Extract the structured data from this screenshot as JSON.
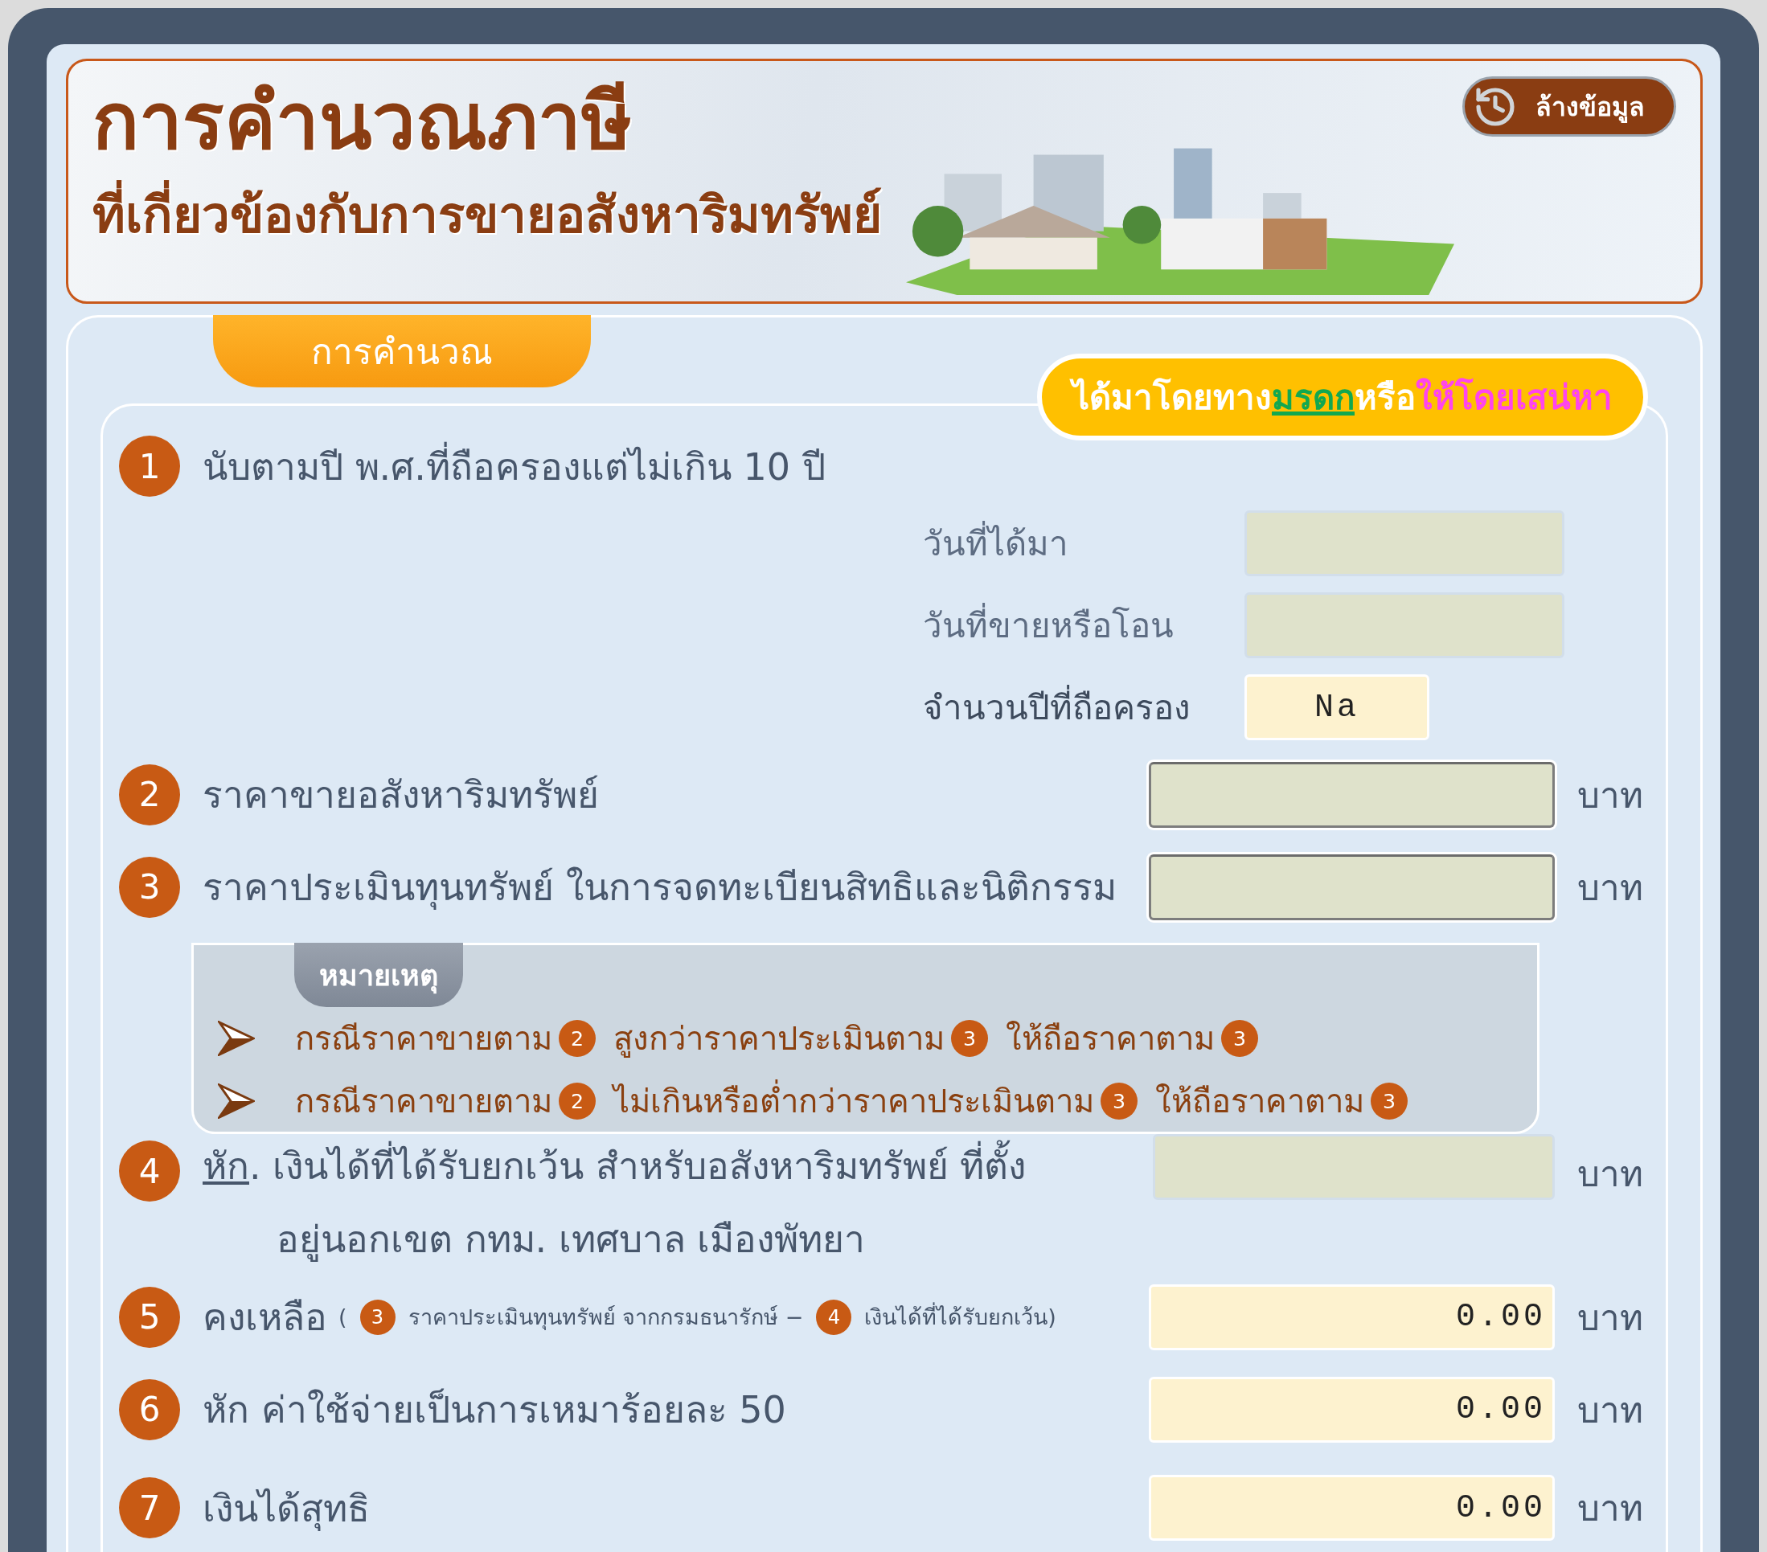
{
  "header": {
    "title": "การคำนวณภาษี",
    "subtitle": "ที่เกี่ยวข้องกับการขายอสังหาริมทรัพย์",
    "clear_button": "ล้างข้อมูล"
  },
  "tab": {
    "label": "การคำนวณ"
  },
  "badge": [
    {
      "text": "ได้มาโดยทาง",
      "kind": "plain"
    },
    {
      "text": "มรดก",
      "kind": "green"
    },
    {
      "text": "หรือ",
      "kind": "plain"
    },
    {
      "text": "ให้โดยเสน่หา",
      "kind": "pink"
    }
  ],
  "rows": [
    {
      "kind": "dates",
      "number": "1",
      "label": "นับตามปี พ.ศ.ที่ถือครองแต่ไม่เกิน 10 ปี",
      "fields": [
        {
          "label": "วันที่ได้มา",
          "kind": "plain"
        },
        {
          "label": "วันที่ขายหรือโอน",
          "kind": "plain"
        },
        {
          "label": "จำนวนปีที่ถือครอง",
          "kind": "result",
          "value": "Na"
        }
      ]
    },
    {
      "kind": "input",
      "number": "2",
      "label": "ราคาขายอสังหาริมทรัพย์",
      "field": {
        "kind": "sunken"
      },
      "unit": "บาท"
    },
    {
      "kind": "input",
      "number": "3",
      "label": "ราคาประเมินทุนทรัพย์ ในการจดทะเบียนสิทธิและนิติกรรม",
      "field": {
        "kind": "sunken"
      },
      "unit": "บาท"
    },
    {
      "kind": "notes",
      "title": "หมายเหตุ",
      "lines": [
        [
          {
            "kind": "text",
            "text": "กรณีราคาขายตาม"
          },
          {
            "kind": "ref",
            "text": "2"
          },
          {
            "kind": "text",
            "text": "สูงกว่าราคาประเมินตาม"
          },
          {
            "kind": "ref",
            "text": "3"
          },
          {
            "kind": "text",
            "text": "ให้ถือราคาตาม"
          },
          {
            "kind": "ref",
            "text": "3"
          }
        ],
        [
          {
            "kind": "text",
            "text": "กรณีราคาขายตาม"
          },
          {
            "kind": "ref",
            "text": "2"
          },
          {
            "kind": "text",
            "text": "ไม่เกินหรือต่ำกว่าราคาประเมินตาม"
          },
          {
            "kind": "ref",
            "text": "3"
          },
          {
            "kind": "text",
            "text": "ให้ถือราคาตาม"
          },
          {
            "kind": "ref",
            "text": "3"
          }
        ]
      ]
    },
    {
      "kind": "input",
      "number": "4",
      "prefix": {
        "text": "หัก",
        "underlined": true
      },
      "label": ". เงินได้ที่ได้รับยกเว้น สำหรับอสังหาริมทรัพย์ ที่ตั้ง",
      "label_line2": "อยู่นอกเขต กทม. เทศบาล  เมืองพัทยา",
      "field": {
        "kind": "plain"
      },
      "unit": "บาท"
    },
    {
      "kind": "input",
      "number": "5",
      "label": "คงเหลือ",
      "formula": [
        {
          "kind": "text",
          "text": "("
        },
        {
          "kind": "ref",
          "text": "3"
        },
        {
          "kind": "text",
          "text": "ราคาประเมินทุนทรัพย์ จากกรมธนารักษ์  −"
        },
        {
          "kind": "ref",
          "text": "4"
        },
        {
          "kind": "text",
          "text": "เงินได้ที่ได้รับยกเว้น)"
        }
      ],
      "field": {
        "kind": "result",
        "value": "0.00"
      },
      "unit": "บาท"
    },
    {
      "kind": "input",
      "number": "6",
      "label": "หัก  ค่าใช้จ่ายเป็นการเหมาร้อยละ 50",
      "field": {
        "kind": "result",
        "value": "0.00"
      },
      "unit": "บาท"
    },
    {
      "kind": "input",
      "number": "7",
      "label": "เงินได้สุทธิ",
      "field": {
        "kind": "result",
        "value": "0.00"
      },
      "unit": "บาท"
    }
  ]
}
